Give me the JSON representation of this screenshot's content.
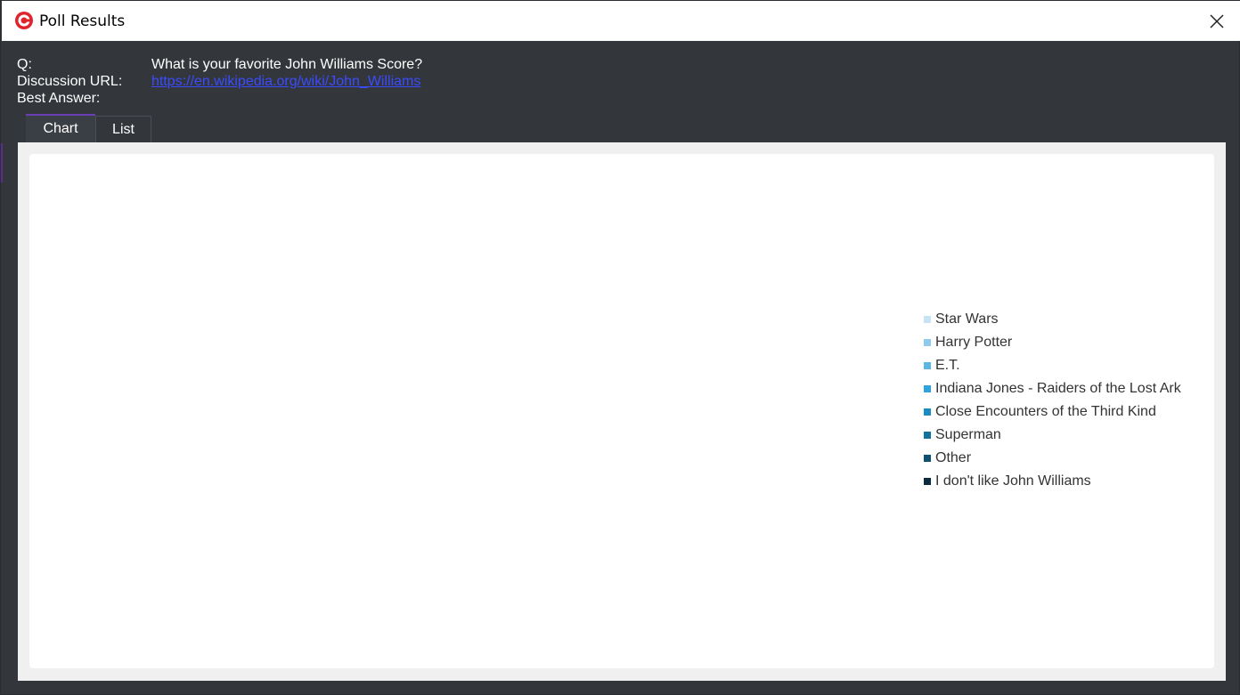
{
  "window": {
    "title": "Poll Results"
  },
  "info": {
    "question_label": "Q:",
    "question_value": "What is your favorite John Williams Score?",
    "url_label": "Discussion URL:",
    "url_value": "https://en.wikipedia.org/wiki/John_Williams",
    "best_answer_label": "Best Answer:",
    "best_answer_value": ""
  },
  "tabs": [
    {
      "label": "Chart",
      "active": true
    },
    {
      "label": "List",
      "active": false
    }
  ],
  "chart_data": {
    "type": "pie",
    "categories": [
      "Star Wars",
      "Harry Potter",
      "E.T.",
      "Indiana Jones - Raiders of the Lost Ark",
      "Close Encounters of the Third Kind",
      "Superman",
      "Other",
      "I don't like John Williams"
    ],
    "colors": [
      "#c6e4f5",
      "#8fcbec",
      "#5cb6e6",
      "#2ea3e0",
      "#1a8bc2",
      "#14709c",
      "#0d5073",
      "#0a2a3d"
    ],
    "legend_position": "right"
  },
  "icons": {
    "app": "app-logo-icon",
    "close": "close-icon"
  }
}
